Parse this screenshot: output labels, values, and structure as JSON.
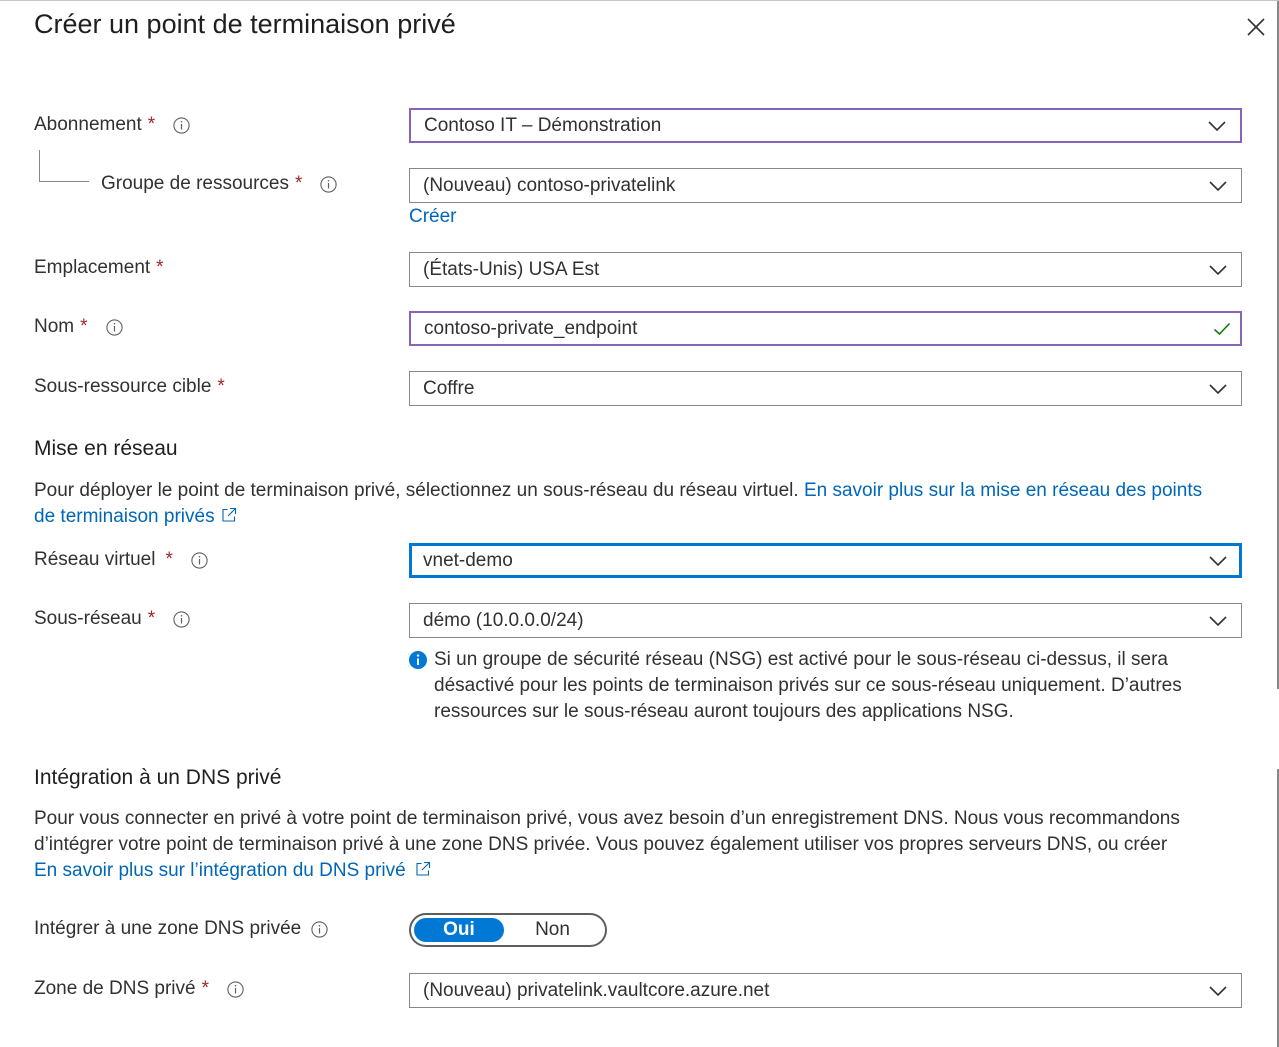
{
  "panel": {
    "title": "Créer un point de terminaison privé",
    "close_icon": "close-icon"
  },
  "fields": {
    "subscription": {
      "label": "Abonnement",
      "required": "*",
      "value": "Contoso IT – Démonstration"
    },
    "resource_group": {
      "label": "Groupe de ressources",
      "required": "*",
      "value": "(Nouveau) contoso-privatelink",
      "create_link": "Créer"
    },
    "location": {
      "label": "Emplacement",
      "required": "*",
      "value": "(États-Unis) USA Est"
    },
    "name": {
      "label": "Nom",
      "required": "*",
      "value": "contoso-private_endpoint"
    },
    "target_subresource": {
      "label": "Sous-ressource cible",
      "required": "*",
      "value": "Coffre"
    }
  },
  "networking": {
    "heading": "Mise en réseau",
    "description": "Pour déployer le point de terminaison privé, sélectionnez un sous-réseau du réseau virtuel.",
    "learn_more_line1": "En savoir plus sur la mise en réseau des points",
    "learn_more_line2": "de terminaison privés",
    "virtual_network": {
      "label": "Réseau virtuel",
      "required": "*",
      "value": "vnet-demo"
    },
    "subnet": {
      "label": "Sous-réseau",
      "required": "*",
      "value": "démo (10.0.0.0/24)"
    },
    "nsg_note_line1": "Si un groupe de sécurité réseau (NSG) est activé pour le sous-réseau ci-dessus, il sera",
    "nsg_note_line2": "désactivé pour les points de terminaison privés sur ce sous-réseau uniquement. D’autres",
    "nsg_note_line3": "ressources sur le sous-réseau auront toujours des applications NSG."
  },
  "dns": {
    "heading": "Intégration à un DNS privé",
    "description_line1": "Pour vous connecter en privé à votre point de terminaison privé, vous avez besoin d’un enregistrement DNS. Nous vous recommandons",
    "description_line2": "d’intégrer votre point de terminaison privé à une zone DNS privée. Vous pouvez également utiliser vos propres serveurs DNS, ou créer",
    "learn_more": "En savoir plus sur l’intégration du DNS privé",
    "integrate": {
      "label": "Intégrer à une zone DNS privée",
      "option_yes": "Oui",
      "option_no": "Non",
      "selected": "Oui"
    },
    "zone": {
      "label": "Zone de DNS privé",
      "required": "*",
      "value": "(Nouveau) privatelink.vaultcore.azure.net"
    }
  },
  "colors": {
    "accent": "#0078d4",
    "link": "#0067b8",
    "required": "#a4262c",
    "validated_border": "#8764b8",
    "check": "#107c10"
  }
}
